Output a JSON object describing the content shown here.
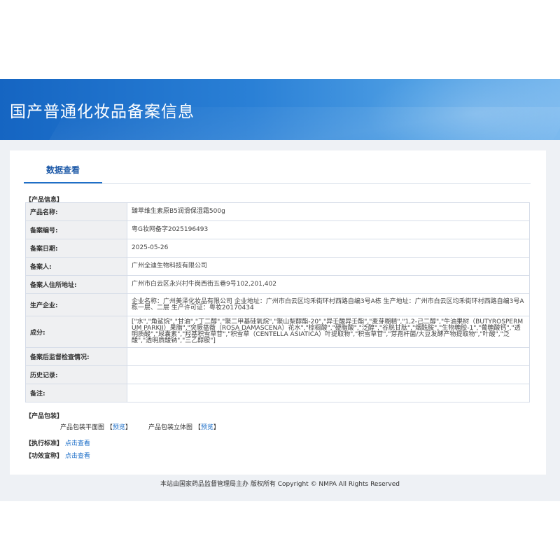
{
  "banner": {
    "title": "国产普通化妆品备案信息"
  },
  "tabs": {
    "active_label": "数据查看"
  },
  "product_section": {
    "heading": "【产品信息】",
    "rows": [
      {
        "label": "产品名称:",
        "value": "臻萃维生素原B5润滑保湿霜500g"
      },
      {
        "label": "备案编号:",
        "value": "粤G妆网备字2025196493"
      },
      {
        "label": "备案日期:",
        "value": "2025-05-26"
      },
      {
        "label": "备案人:",
        "value": "广州全迪生物科技有限公司"
      },
      {
        "label": "备案人住所地址:",
        "value": "广州市白云区永兴村牛岗西街五巷9号102,201,402"
      },
      {
        "label": "生产企业:",
        "value": "企业名称：广州美泽化妆品有限公司 企业地址：广州市白云区均禾街环村西路自编3号A栋 生产地址：广州市白云区均禾街环村西路自编3号A栋一层、二层 生产许可证：粤妆20170434"
      },
      {
        "label": "成分:",
        "value": "[\"水\",\"角鲨烷\",\"甘油\",\"丁二醇\",\"聚二甲基硅氧烷\",\"聚山梨醇酯-20\",\"异壬酸异壬酯\",\"麦芽糊精\",\"1,2-己二醇\",\"牛油果树（BUTYROSPERMUM PARKII）果脂\",\"突厥蔷薇（ROSA DAMASCENA）花水\",\"棕榈酸\",\"硬脂酸\",\"泛醇\",\"谷胱甘肽\",\"烟酰胺\",\"生物糖胶-1\",\"葡糖酸钙\",\"透明质酸\",\"尿囊素\",\"羟基积雪草苷\",\"积雪草（CENTELLA ASIATICA）叶提取物\",\"积雪草苷\",\"芽孢杆菌/大豆发酵产物提取物\",\"叶酸\",\"泛酸\",\"透明质酸钠\",\"三乙醇胺\"]"
      },
      {
        "label": "备案后监督检查情况:",
        "value": ""
      },
      {
        "label": "历史记录:",
        "value": ""
      },
      {
        "label": "备注:",
        "value": ""
      }
    ]
  },
  "packaging": {
    "heading": "【产品包装】",
    "flat_label": "产品包装平面图",
    "solid_label": "产品包装立体图",
    "bracket_open": "【",
    "bracket_close": "】",
    "preview_link": "预览"
  },
  "standard": {
    "heading": "【执行标准】",
    "link": "点击查看"
  },
  "claims": {
    "heading": "【功效宣称】",
    "link": "点击查看"
  },
  "footer": {
    "text": "本站由国家药品监督管理局主办 版权所有 Copyright © NMPA All Rights Reserved"
  }
}
